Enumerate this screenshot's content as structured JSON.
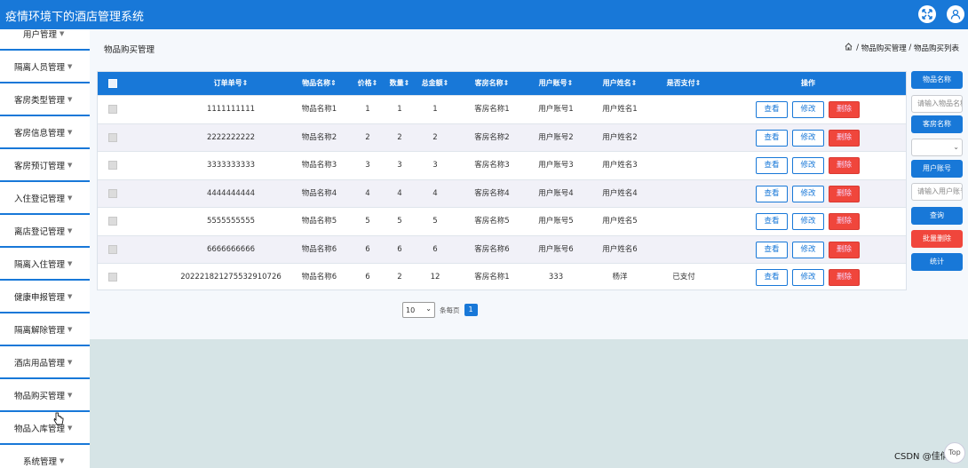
{
  "app": {
    "title": "疫情环境下的酒店管理系统"
  },
  "sidebar": {
    "items": [
      {
        "label": "用户管理"
      },
      {
        "label": "隔离人员管理"
      },
      {
        "label": "客房类型管理"
      },
      {
        "label": "客房信息管理"
      },
      {
        "label": "客房预订管理"
      },
      {
        "label": "入住登记管理"
      },
      {
        "label": "离店登记管理"
      },
      {
        "label": "隔离入住管理"
      },
      {
        "label": "健康申报管理"
      },
      {
        "label": "隔离解除管理"
      },
      {
        "label": "酒店用品管理"
      },
      {
        "label": "物品购买管理"
      },
      {
        "label": "物品入库管理"
      },
      {
        "label": "系统管理"
      }
    ]
  },
  "header": {
    "page_title": "物品购买管理",
    "breadcrumb": [
      "物品购买管理",
      "物品购买列表"
    ],
    "breadcrumb_sep": "/"
  },
  "table": {
    "columns": [
      "订单单号",
      "物品名称",
      "价格",
      "数量",
      "总金额",
      "客房名称",
      "用户账号",
      "用户姓名",
      "是否支付",
      "操作"
    ],
    "rows": [
      {
        "order": "1111111111",
        "item": "物品名称1",
        "price": "1",
        "qty": "1",
        "total": "1",
        "room": "客房名称1",
        "account": "用户账号1",
        "name": "用户姓名1",
        "paid": ""
      },
      {
        "order": "2222222222",
        "item": "物品名称2",
        "price": "2",
        "qty": "2",
        "total": "2",
        "room": "客房名称2",
        "account": "用户账号2",
        "name": "用户姓名2",
        "paid": ""
      },
      {
        "order": "3333333333",
        "item": "物品名称3",
        "price": "3",
        "qty": "3",
        "total": "3",
        "room": "客房名称3",
        "account": "用户账号3",
        "name": "用户姓名3",
        "paid": ""
      },
      {
        "order": "4444444444",
        "item": "物品名称4",
        "price": "4",
        "qty": "4",
        "total": "4",
        "room": "客房名称4",
        "account": "用户账号4",
        "name": "用户姓名4",
        "paid": ""
      },
      {
        "order": "5555555555",
        "item": "物品名称5",
        "price": "5",
        "qty": "5",
        "total": "5",
        "room": "客房名称5",
        "account": "用户账号5",
        "name": "用户姓名5",
        "paid": ""
      },
      {
        "order": "6666666666",
        "item": "物品名称6",
        "price": "6",
        "qty": "6",
        "total": "6",
        "room": "客房名称6",
        "account": "用户账号6",
        "name": "用户姓名6",
        "paid": ""
      },
      {
        "order": "20222182127553291072​6",
        "item": "物品名称6",
        "price": "6",
        "qty": "2",
        "total": "12",
        "room": "客房名称1",
        "account": "333",
        "name": "杨洋",
        "paid": "已支付"
      }
    ],
    "actions": {
      "view": "查看",
      "edit": "修改",
      "delete": "删除"
    }
  },
  "pagination": {
    "page_size": "10",
    "per_page_label": "条每页",
    "current_page": "1"
  },
  "search_panel": {
    "item_name_label": "物品名称",
    "item_name_placeholder": "请输入物品名称",
    "room_name_label": "客房名称",
    "room_name_value": "",
    "account_label": "用户账号",
    "account_placeholder": "请输入用户账号",
    "query_button": "查询",
    "batch_delete_button": "批量删除",
    "stats_button": "统计"
  },
  "watermark": "CSDN @佳倩",
  "float_button": "Top",
  "colors": {
    "primary": "#1878d8",
    "danger": "#f0463c",
    "background": "#d6e4e6"
  },
  "icons": {
    "expand": "arrows-expand-icon",
    "user": "user-avatar-icon",
    "home": "home-icon",
    "caret": "caret-down-icon",
    "sort": "sort-icon"
  }
}
